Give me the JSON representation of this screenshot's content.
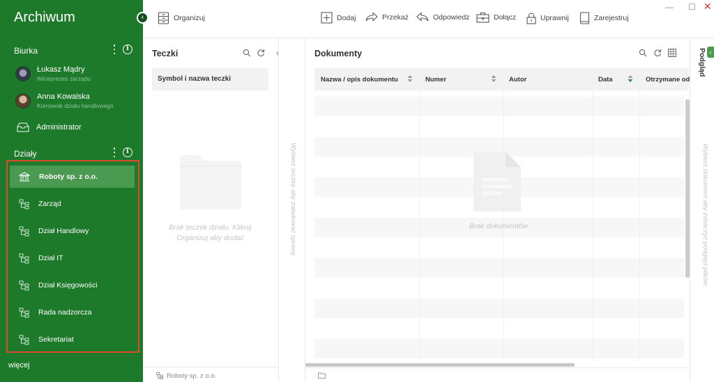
{
  "app": {
    "title": "Archiwum"
  },
  "sidebar": {
    "desks_label": "Biurka",
    "users": [
      {
        "name": "Łukasz Mądry",
        "role": "Wiceprezes zarządu"
      },
      {
        "name": "Anna Kowalska",
        "role": "Kierownik działu handlowego"
      }
    ],
    "admin_label": "Administrator",
    "departments_label": "Działy",
    "departments": [
      {
        "label": "Roboty sp. z o.o.",
        "selected": true
      },
      {
        "label": "Zarząd"
      },
      {
        "label": "Dział Handlowy"
      },
      {
        "label": "Dział IT"
      },
      {
        "label": "Dział Księgowości"
      },
      {
        "label": "Rada nadzorcza"
      },
      {
        "label": "Sekretariat"
      }
    ],
    "more_label": "więcej"
  },
  "toolbar": {
    "organize": "Organizuj",
    "add": "Dodaj",
    "forward": "Przekaż",
    "reply": "Odpowiedz",
    "attach": "Dołącz",
    "permissions": "Uprawnij",
    "register": "Zarejestruj"
  },
  "folders": {
    "title": "Teczki",
    "column_header": "Symbol i nazwa teczki",
    "empty_line1": "Brak teczek działu. Kliknij",
    "empty_line2": "Organizuj aby dodać",
    "vertical_hint": "Wybierz teczkę aby załadować sprawy",
    "footer": "Roboty sp. z o.o."
  },
  "documents": {
    "title": "Dokumenty",
    "columns": [
      "Nazwa / opis dokumentu",
      "Numer",
      "Autor",
      "Data",
      "Otrzymane od"
    ],
    "empty": "Brak dokumentów"
  },
  "preview": {
    "tab": "Podgląd",
    "vertical_hint": "Wybierz dokument aby zobaczyć podgląd plików"
  },
  "colors": {
    "sidebar": "#1e7a2b",
    "selected": "#4a9a52",
    "highlight_border": "#e04a2c"
  }
}
